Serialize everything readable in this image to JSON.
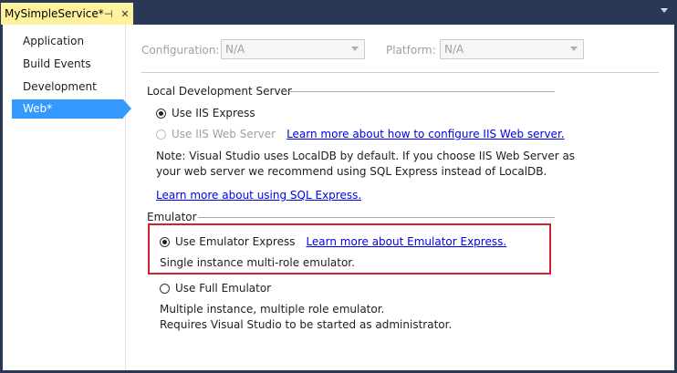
{
  "tab": {
    "title": "MySimpleService*",
    "pin_glyph": "⊣",
    "close_glyph": "✕"
  },
  "sidebar": {
    "items": [
      {
        "label": "Application"
      },
      {
        "label": "Build Events"
      },
      {
        "label": "Development"
      },
      {
        "label": "Web*"
      }
    ],
    "selected": "Web*"
  },
  "config_row": {
    "configuration_label": "Configuration:",
    "configuration_value": "N/A",
    "platform_label": "Platform:",
    "platform_value": "N/A"
  },
  "local_dev_server": {
    "header": "Local Development Server",
    "iis_express_label": "Use IIS Express",
    "iis_web_server_label": "Use IIS Web Server",
    "iis_web_server_link": "Learn more about how to configure IIS Web server.",
    "note_line1": "Note: Visual Studio uses LocalDB by default.  If you choose IIS Web Server as",
    "note_line2": "your web server we recommend using SQL Express instead of LocalDB.",
    "sql_express_link": "Learn more about using SQL Express."
  },
  "emulator": {
    "header": "Emulator",
    "express_label": "Use Emulator Express",
    "express_link": "Learn more about Emulator Express.",
    "express_desc": "Single instance multi-role emulator.",
    "full_label": "Use Full Emulator",
    "full_desc_line1": "Multiple instance, multiple role emulator.",
    "full_desc_line2": "Requires Visual Studio to be started as administrator."
  },
  "colors": {
    "tab_bg": "#fff29d",
    "frame_bg": "#293955",
    "selection": "#3399ff",
    "highlight_box": "#d1202f",
    "link": "#0000ee"
  }
}
